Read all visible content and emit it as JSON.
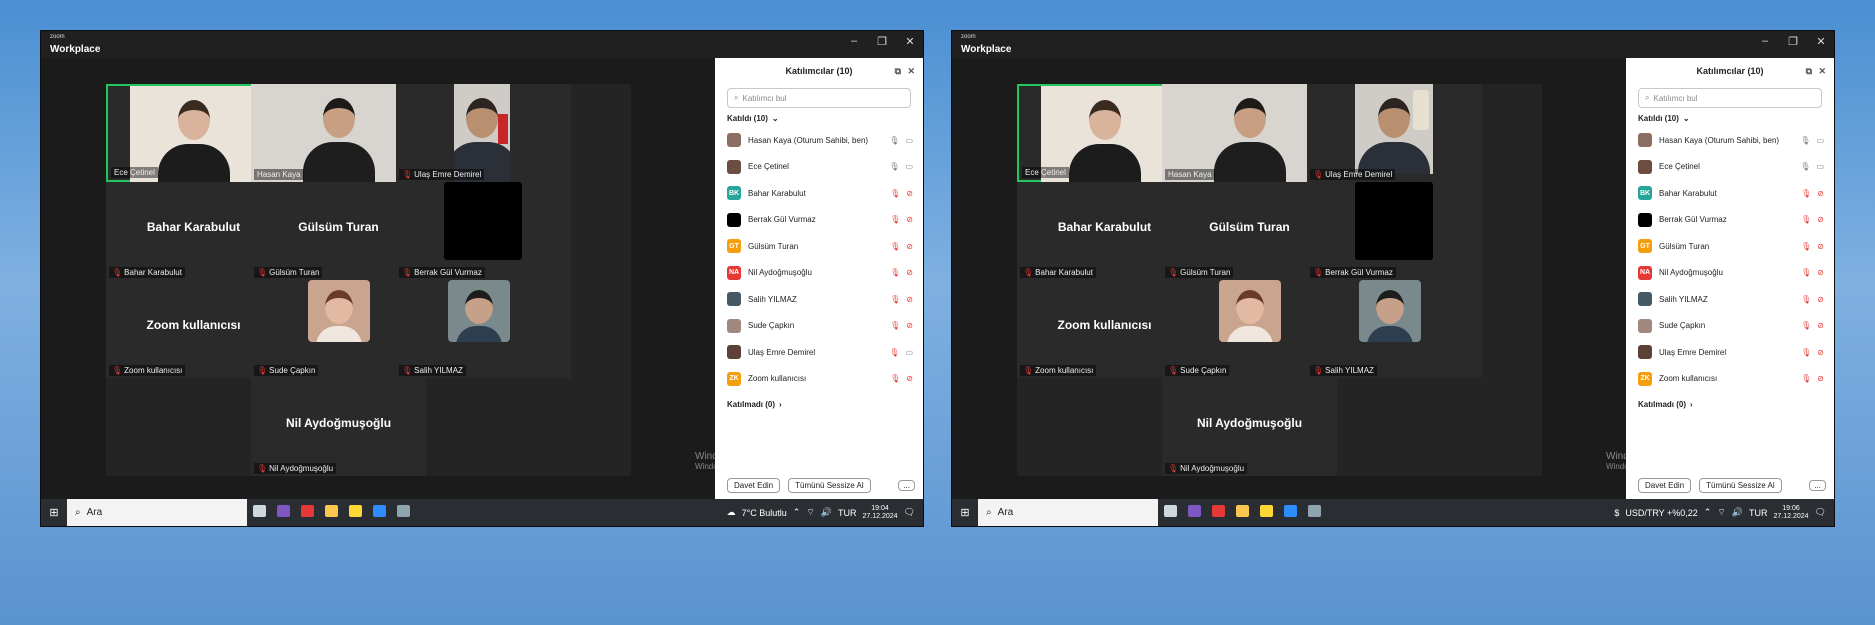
{
  "windows": [
    {
      "side": "left",
      "app": {
        "brand_small": "zoom",
        "brand": "Workplace"
      },
      "video_tiles": [
        {
          "name": "Ece Çetinel",
          "muted": false,
          "active": true,
          "kind": "video"
        },
        {
          "name": "Hasan Kaya",
          "muted": false,
          "active": false,
          "kind": "video"
        },
        {
          "name": "Ulaş Emre Demirel",
          "muted": true,
          "active": false,
          "kind": "video"
        },
        {
          "name": "Bahar Karabulut",
          "muted": true,
          "kind": "name",
          "big": "Bahar Karabulut"
        },
        {
          "name": "Gülsüm Turan",
          "muted": true,
          "kind": "name",
          "big": "Gülsüm Turan"
        },
        {
          "name": "Berrak Gül Vurmaz",
          "muted": true,
          "kind": "black"
        },
        {
          "name": "Zoom kullanıcısı",
          "muted": true,
          "kind": "name",
          "big": "Zoom kullanıcısı"
        },
        {
          "name": "Sude Çapkın",
          "muted": true,
          "kind": "avatar"
        },
        {
          "name": "Salih YILMAZ",
          "muted": true,
          "kind": "avatar"
        },
        {
          "name": "Nil Aydoğmuşoğlu",
          "muted": true,
          "kind": "name",
          "big": "Nil Aydoğmuşoğlu"
        }
      ],
      "panel": {
        "title": "Katılımcılar (10)",
        "search_placeholder": "Katılımcı bul",
        "joined_label": "Katıldı (10)",
        "not_joined_label": "Katılmadı (0)",
        "participants": [
          {
            "name": "Hasan Kaya (Oturum Sahibi, ben)",
            "initials": "",
            "color": "#8d6e63",
            "mic": "on",
            "cam": "on"
          },
          {
            "name": "Ece Çetinel",
            "initials": "",
            "color": "#6d4c41",
            "mic": "on",
            "cam": "on"
          },
          {
            "name": "Bahar Karabulut",
            "initials": "BK",
            "color": "#26a69a",
            "mic": "off",
            "cam": "off"
          },
          {
            "name": "Berrak Gül Vurmaz",
            "initials": "",
            "color": "#000000",
            "mic": "off",
            "cam": "off"
          },
          {
            "name": "Gülsüm Turan",
            "initials": "GT",
            "color": "#f59e0b",
            "mic": "off",
            "cam": "off"
          },
          {
            "name": "Nil Aydoğmuşoğlu",
            "initials": "NA",
            "color": "#e53935",
            "mic": "off",
            "cam": "off"
          },
          {
            "name": "Salih YILMAZ",
            "initials": "",
            "color": "#455a64",
            "mic": "off",
            "cam": "off"
          },
          {
            "name": "Sude Çapkın",
            "initials": "",
            "color": "#a1887f",
            "mic": "off",
            "cam": "off"
          },
          {
            "name": "Ulaş Emre Demirel",
            "initials": "",
            "color": "#5d4037",
            "mic": "off",
            "cam": "on"
          },
          {
            "name": "Zoom kullanıcısı",
            "initials": "ZK",
            "color": "#f59e0b",
            "mic": "off",
            "cam": "off"
          }
        ],
        "invite_label": "Davet Edin",
        "mute_all_label": "Tümünü Sessize Al",
        "more_label": "..."
      },
      "watermark": {
        "line1": "Windows'u Etkinleştir",
        "line2": "Windows'u etkinleştirmek için Ayarlar'a gidin."
      },
      "taskbar": {
        "search": "Ara",
        "widget": "7°C  Bulutlu",
        "lang": "TUR",
        "time": "19:04",
        "date": "27.12.2024"
      }
    },
    {
      "side": "right",
      "app": {
        "brand_small": "zoom",
        "brand": "Workplace"
      },
      "video_tiles": [
        {
          "name": "Ece Çetinel",
          "muted": false,
          "active": true,
          "kind": "video"
        },
        {
          "name": "Hasan Kaya",
          "muted": false,
          "active": false,
          "kind": "video"
        },
        {
          "name": "Ulaş Emre Demirel",
          "muted": true,
          "active": false,
          "kind": "video"
        },
        {
          "name": "Bahar Karabulut",
          "muted": true,
          "kind": "name",
          "big": "Bahar Karabulut"
        },
        {
          "name": "Gülsüm Turan",
          "muted": true,
          "kind": "name",
          "big": "Gülsüm Turan"
        },
        {
          "name": "Berrak Gül Vurmaz",
          "muted": true,
          "kind": "black"
        },
        {
          "name": "Zoom kullanıcısı",
          "muted": true,
          "kind": "name",
          "big": "Zoom kullanıcısı"
        },
        {
          "name": "Sude Çapkın",
          "muted": true,
          "kind": "avatar"
        },
        {
          "name": "Salih YILMAZ",
          "muted": true,
          "kind": "avatar"
        },
        {
          "name": "Nil Aydoğmuşoğlu",
          "muted": true,
          "kind": "name",
          "big": "Nil Aydoğmuşoğlu"
        }
      ],
      "panel": {
        "title": "Katılımcılar (10)",
        "search_placeholder": "Katılımcı bul",
        "joined_label": "Katıldı (10)",
        "not_joined_label": "Katılmadı (0)",
        "participants": [
          {
            "name": "Hasan Kaya (Oturum Sahibi, ben)",
            "initials": "",
            "color": "#8d6e63",
            "mic": "on",
            "cam": "on"
          },
          {
            "name": "Ece Çetinel",
            "initials": "",
            "color": "#6d4c41",
            "mic": "on",
            "cam": "on"
          },
          {
            "name": "Bahar Karabulut",
            "initials": "BK",
            "color": "#26a69a",
            "mic": "off",
            "cam": "off"
          },
          {
            "name": "Berrak Gül Vurmaz",
            "initials": "",
            "color": "#000000",
            "mic": "off",
            "cam": "off"
          },
          {
            "name": "Gülsüm Turan",
            "initials": "GT",
            "color": "#f59e0b",
            "mic": "off",
            "cam": "off"
          },
          {
            "name": "Nil Aydoğmuşoğlu",
            "initials": "NA",
            "color": "#e53935",
            "mic": "off",
            "cam": "off"
          },
          {
            "name": "Salih YILMAZ",
            "initials": "",
            "color": "#455a64",
            "mic": "off",
            "cam": "off"
          },
          {
            "name": "Sude Çapkın",
            "initials": "",
            "color": "#a1887f",
            "mic": "off",
            "cam": "off"
          },
          {
            "name": "Ulaş Emre Demirel",
            "initials": "",
            "color": "#5d4037",
            "mic": "off",
            "cam": "off"
          },
          {
            "name": "Zoom kullanıcısı",
            "initials": "ZK",
            "color": "#f59e0b",
            "mic": "off",
            "cam": "off"
          }
        ],
        "invite_label": "Davet Edin",
        "mute_all_label": "Tümünü Sessize Al",
        "more_label": "..."
      },
      "watermark": {
        "line1": "Windows'u Etkinleştir",
        "line2": "Windows'u etkinleştirmek için Ayarlar'a gidin."
      },
      "taskbar": {
        "search": "Ara",
        "widget": "USD/TRY  +%0,22",
        "lang": "TUR",
        "time": "19:06",
        "date": "27.12.2024"
      }
    }
  ]
}
